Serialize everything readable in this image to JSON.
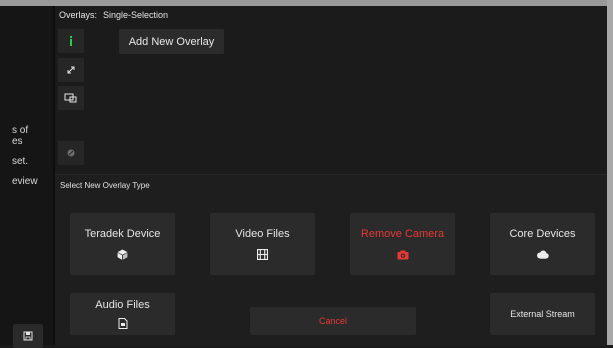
{
  "colors": {
    "accent_green": "#2ecc40",
    "danger_red": "#e53935"
  },
  "sidebar": {
    "fragments": [
      "s of",
      "es",
      "set.",
      "eview"
    ],
    "save_icon": "save-icon"
  },
  "overlays": {
    "header_label": "Overlays:",
    "mode": "Single-Selection",
    "tool_icons": [
      "info-icon",
      "expand-icon",
      "resize-icon",
      "disabled-round-icon"
    ],
    "add_button": "Add New Overlay"
  },
  "overlay_type": {
    "header": "Select New Overlay Type",
    "options": [
      {
        "label": "Teradek Device",
        "icon": "cube-icon"
      },
      {
        "label": "Video Files",
        "icon": "film-icon"
      },
      {
        "label": "Remove Camera",
        "icon": "camera-icon"
      },
      {
        "label": "Core Devices",
        "icon": "cloud-icon"
      },
      {
        "label": "Audio Files",
        "icon": "audio-file-icon"
      }
    ],
    "cancel": "Cancel",
    "external_stream": "External Stream"
  }
}
